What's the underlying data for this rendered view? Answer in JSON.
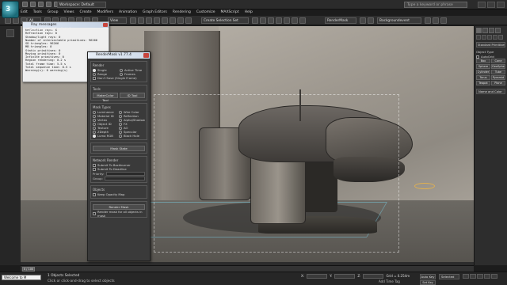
{
  "titlebar": {
    "logo_text": "3",
    "workspace": "Workspace: Default",
    "window_title": "",
    "search_placeholder": "Type a keyword or phrase"
  },
  "menu": [
    "Edit",
    "Tools",
    "Group",
    "Views",
    "Create",
    "Modifiers",
    "Animation",
    "Graph Editors",
    "Rendering",
    "Customize",
    "MAXScript",
    "Help"
  ],
  "toolbar": {
    "filter": "All",
    "view": "View",
    "selection_set": "Create Selection Set",
    "render_preset": "RenderMask",
    "background": "Backgroundevent"
  },
  "viewport": {
    "label": "[+][Perspective][Realistic]"
  },
  "ray_messages": {
    "title": "Ray messages",
    "lines": [
      "Reflection rays: 0",
      "Refraction rays: 0",
      "Shadow/light rays: 0",
      "Number of intersectable primitives: 96266",
      "SD triangles: 96266",
      "MB triangles: 0",
      "Static primitives: 0",
      "Moving primitives: 0",
      "Infinite primitives: 0",
      "Region rendering: 0.2 s",
      "Total frame time: 5.5 s",
      "Total sequence time: 8.5 s",
      "Warning(s): 0 warning(s)"
    ]
  },
  "render_mask": {
    "title": "RenderMask v1.77.4",
    "render_label": "Render",
    "range": [
      "Single",
      "Active Time",
      "Range",
      "Frames"
    ],
    "dont_save": "Don't Save (Single Frame)",
    "tools_label": "Tools",
    "tools_buttons": [
      "MaterColor Tool",
      "ID Tool"
    ],
    "mask_types_label": "Mask Types",
    "mask_types": [
      "Luminance",
      "Material ID",
      "Vertex",
      "Object ID",
      "Texture",
      "ZDepth",
      "Luma RGB",
      "Wire Color",
      "Reflection",
      "Alpha/Shadow",
      "FX",
      "AO",
      "Specular",
      "Black Hole"
    ],
    "mask_state_button": "Mask State",
    "network_label": "Network Render",
    "network_options": [
      "Submit To Backburner",
      "Submit To Deadline"
    ],
    "priority_label": "Priority:",
    "group_label": "Group:",
    "objects_label": "Objects",
    "keep_opacity": "Keep Opacity Map",
    "render_mask_button": "Render Mask",
    "footer": "Render mask for all objects in mask"
  },
  "command_panel": {
    "category": "Standard Primitives",
    "object_type": "Object Type",
    "autogrid": "AutoGrid",
    "buttons": [
      "Box",
      "Cone",
      "Sphere",
      "GeoSphere",
      "Cylinder",
      "Tube",
      "Torus",
      "Pyramid",
      "Teapot",
      "Plane"
    ],
    "name_and_color": "Name and Color"
  },
  "timeline": {
    "position": "0 / 100"
  },
  "status": {
    "maxscript": "Welcome to M",
    "selection": "1 Objects Selected",
    "hint": "Click or click-and-drag to select objects",
    "x": "X:",
    "y": "Y:",
    "z": "Z:",
    "grid": "Grid = 0.254m",
    "add_time_tag": "Add Time Tag",
    "auto_key": "Auto Key",
    "selected": "Selected",
    "set_key": "Set Key"
  }
}
